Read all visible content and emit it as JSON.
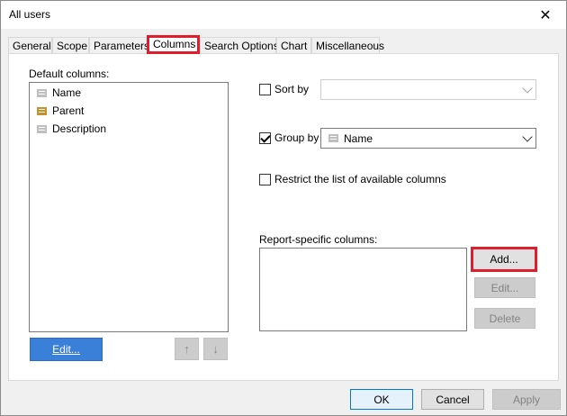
{
  "window": {
    "title": "All users"
  },
  "tabs": [
    {
      "label": "General"
    },
    {
      "label": "Scope"
    },
    {
      "label": "Parameters"
    },
    {
      "label": "Columns"
    },
    {
      "label": "Search Options"
    },
    {
      "label": "Chart"
    },
    {
      "label": "Miscellaneous"
    }
  ],
  "active_tab": "Columns",
  "default_columns": {
    "label": "Default columns:",
    "items": [
      {
        "label": "Name",
        "icon": "column-icon"
      },
      {
        "label": "Parent",
        "icon": "parent-column-icon"
      },
      {
        "label": "Description",
        "icon": "column-icon"
      }
    ],
    "edit_button": "Edit...",
    "move_up_icon": "↑",
    "move_down_icon": "↓"
  },
  "sort_by": {
    "label": "Sort by",
    "checked": false,
    "value": ""
  },
  "group_by": {
    "label": "Group by",
    "checked": true,
    "value": "Name"
  },
  "restrict": {
    "label": "Restrict the list of available columns",
    "checked": false
  },
  "report_columns": {
    "label": "Report-specific columns:",
    "add_button": "Add...",
    "edit_button": "Edit...",
    "delete_button": "Delete"
  },
  "footer": {
    "ok": "OK",
    "cancel": "Cancel",
    "apply": "Apply"
  },
  "colors": {
    "highlight": "#e01d2d",
    "primary": "#3a80d9",
    "parent_icon": "#c8902a"
  }
}
